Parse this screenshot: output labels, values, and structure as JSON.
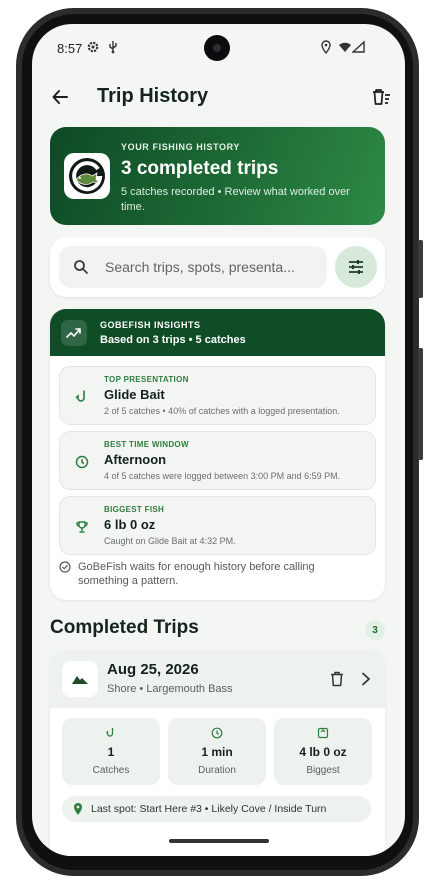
{
  "status": {
    "time": "8:57"
  },
  "appbar": {
    "title": "Trip History"
  },
  "hero": {
    "eyebrow": "YOUR FISHING HISTORY",
    "title": "3 completed trips",
    "subtitle": "5 catches recorded • Review what worked over time."
  },
  "search": {
    "placeholder": "Search trips, spots, presenta..."
  },
  "insights": {
    "eyebrow": "GOBEFISH INSIGHTS",
    "subtitle": "Based on 3 trips • 5 catches",
    "items": [
      {
        "eyebrow": "TOP PRESENTATION",
        "title": "Glide Bait",
        "desc": "2 of 5 catches • 40% of catches with a logged presentation.",
        "icon": "hook-icon"
      },
      {
        "eyebrow": "BEST TIME WINDOW",
        "title": "Afternoon",
        "desc": "4 of 5 catches were logged between 3:00 PM and 6:59 PM.",
        "icon": "clock-icon"
      },
      {
        "eyebrow": "BIGGEST FISH",
        "title": "6 lb 0 oz",
        "desc": "Caught on Glide Bait at 4:32 PM.",
        "icon": "trophy-icon"
      }
    ],
    "note": "GoBeFish waits for enough history before calling something a pattern."
  },
  "section": {
    "title": "Completed Trips",
    "count": "3"
  },
  "trip": {
    "date": "Aug 25, 2026",
    "meta": "Shore • Largemouth Bass",
    "stats": [
      {
        "value": "1",
        "label": "Catches"
      },
      {
        "value": "1 min",
        "label": "Duration"
      },
      {
        "value": "4 lb 0 oz",
        "label": "Biggest"
      }
    ],
    "spot": "Last spot: Start Here #3 • Likely Cove / Inside Turn"
  },
  "colors": {
    "primary": "#0f4d27",
    "accent": "#2e7d3e",
    "surface": "#f4f6f4"
  }
}
